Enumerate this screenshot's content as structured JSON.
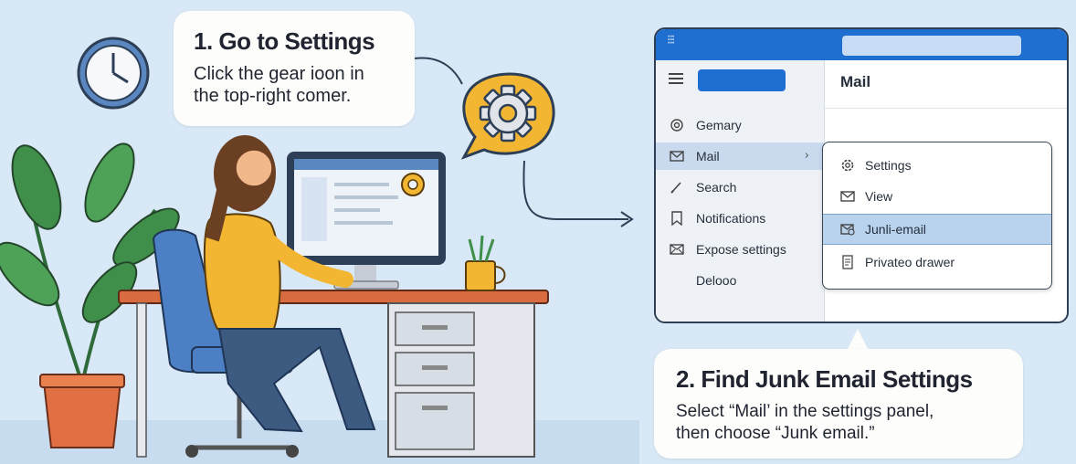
{
  "step1": {
    "title": "1. Go to Settings",
    "body_line1": "Click the gear ioon in",
    "body_line2": "the top-right comer."
  },
  "step2": {
    "title": "2. Find Junk Email Settings",
    "body_line1": "Select “Mail’ in the settings panel,",
    "body_line2": "then choose “Junk email.”"
  },
  "mail_app": {
    "pane_title": "Mail",
    "nav_items": [
      {
        "label": "Gemary",
        "icon": "settings-ring-icon"
      },
      {
        "label": "Mail",
        "icon": "envelope-icon",
        "active": true
      },
      {
        "label": "Search",
        "icon": "pencil-icon"
      },
      {
        "label": "Notifications",
        "icon": "bookmark-icon"
      },
      {
        "label": "Expose settings",
        "icon": "mail-box-icon"
      },
      {
        "label": "Delooo",
        "icon": ""
      }
    ],
    "submenu_items": [
      {
        "label": "Settings",
        "icon": "gear-icon"
      },
      {
        "label": "View",
        "icon": "envelope-icon"
      },
      {
        "label": "Junli-email",
        "icon": "junk-mail-icon",
        "active": true
      },
      {
        "label": "Privateo drawer",
        "icon": "document-icon"
      }
    ]
  },
  "colors": {
    "background": "#d9e8f6",
    "accent_blue": "#1e6fd0",
    "gear_yellow": "#f2b632",
    "highlight": "#b9d3ee"
  }
}
